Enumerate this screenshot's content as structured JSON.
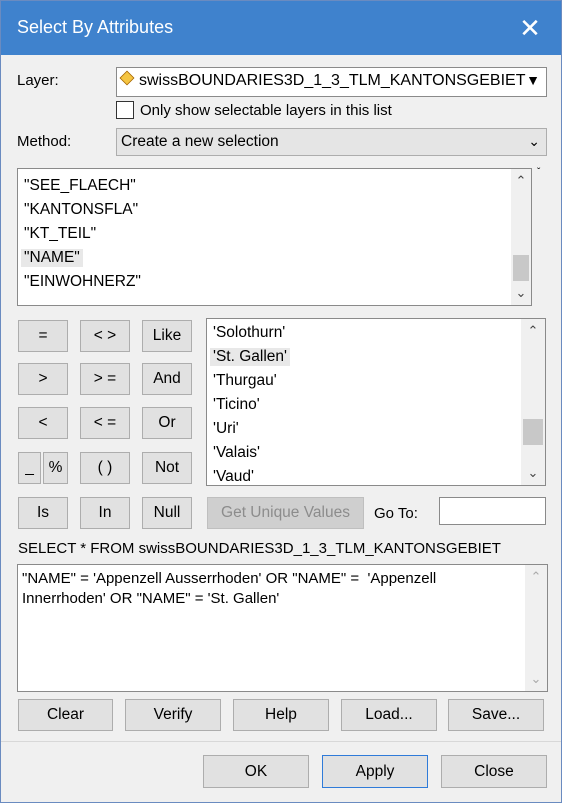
{
  "window": {
    "title": "Select By Attributes",
    "close_glyph": "✕"
  },
  "layer": {
    "label": "Layer:",
    "value": "swissBOUNDARIES3D_1_3_TLM_KANTONSGEBIET",
    "checkbox_label": "Only show selectable layers in this list"
  },
  "method": {
    "label": "Method:",
    "value": "Create a new selection"
  },
  "fields": [
    "\"SEE_FLAECH\"",
    "\"KANTONSFLA\"",
    "\"KT_TEIL\"",
    "\"NAME\"",
    "\"EINWOHNERZ\""
  ],
  "fields_selected": "\"NAME\"",
  "operators": {
    "eq": "=",
    "ne": "< >",
    "like": "Like",
    "gt": ">",
    "ge": "> =",
    "and": "And",
    "lt": "<",
    "le": "< =",
    "or": "Or",
    "underscore": "_",
    "percent": "%",
    "parens": "( )",
    "not": "Not",
    "is": "Is",
    "in": "In",
    "null": "Null"
  },
  "values": [
    "'Solothurn'",
    "'St. Gallen'",
    "'Thurgau'",
    "'Ticino'",
    "'Uri'",
    "'Valais'",
    "'Vaud'"
  ],
  "values_selected": "'St. Gallen'",
  "unique": {
    "button": "Get Unique Values",
    "goto_label": "Go To:",
    "goto_value": ""
  },
  "query": {
    "header": "SELECT * FROM swissBOUNDARIES3D_1_3_TLM_KANTONSGEBIET",
    "expression": "\"NAME\" = 'Appenzell Ausserrhoden' OR \"NAME\" =  'Appenzell Innerrhoden' OR \"NAME\" = 'St. Gallen'"
  },
  "actions": {
    "clear": "Clear",
    "verify": "Verify",
    "help": "Help",
    "load": "Load...",
    "save": "Save..."
  },
  "footer": {
    "ok": "OK",
    "apply": "Apply",
    "close": "Close"
  },
  "colors": {
    "titlebar": "#3f82cd",
    "default_button_border": "#2f7bd9"
  }
}
